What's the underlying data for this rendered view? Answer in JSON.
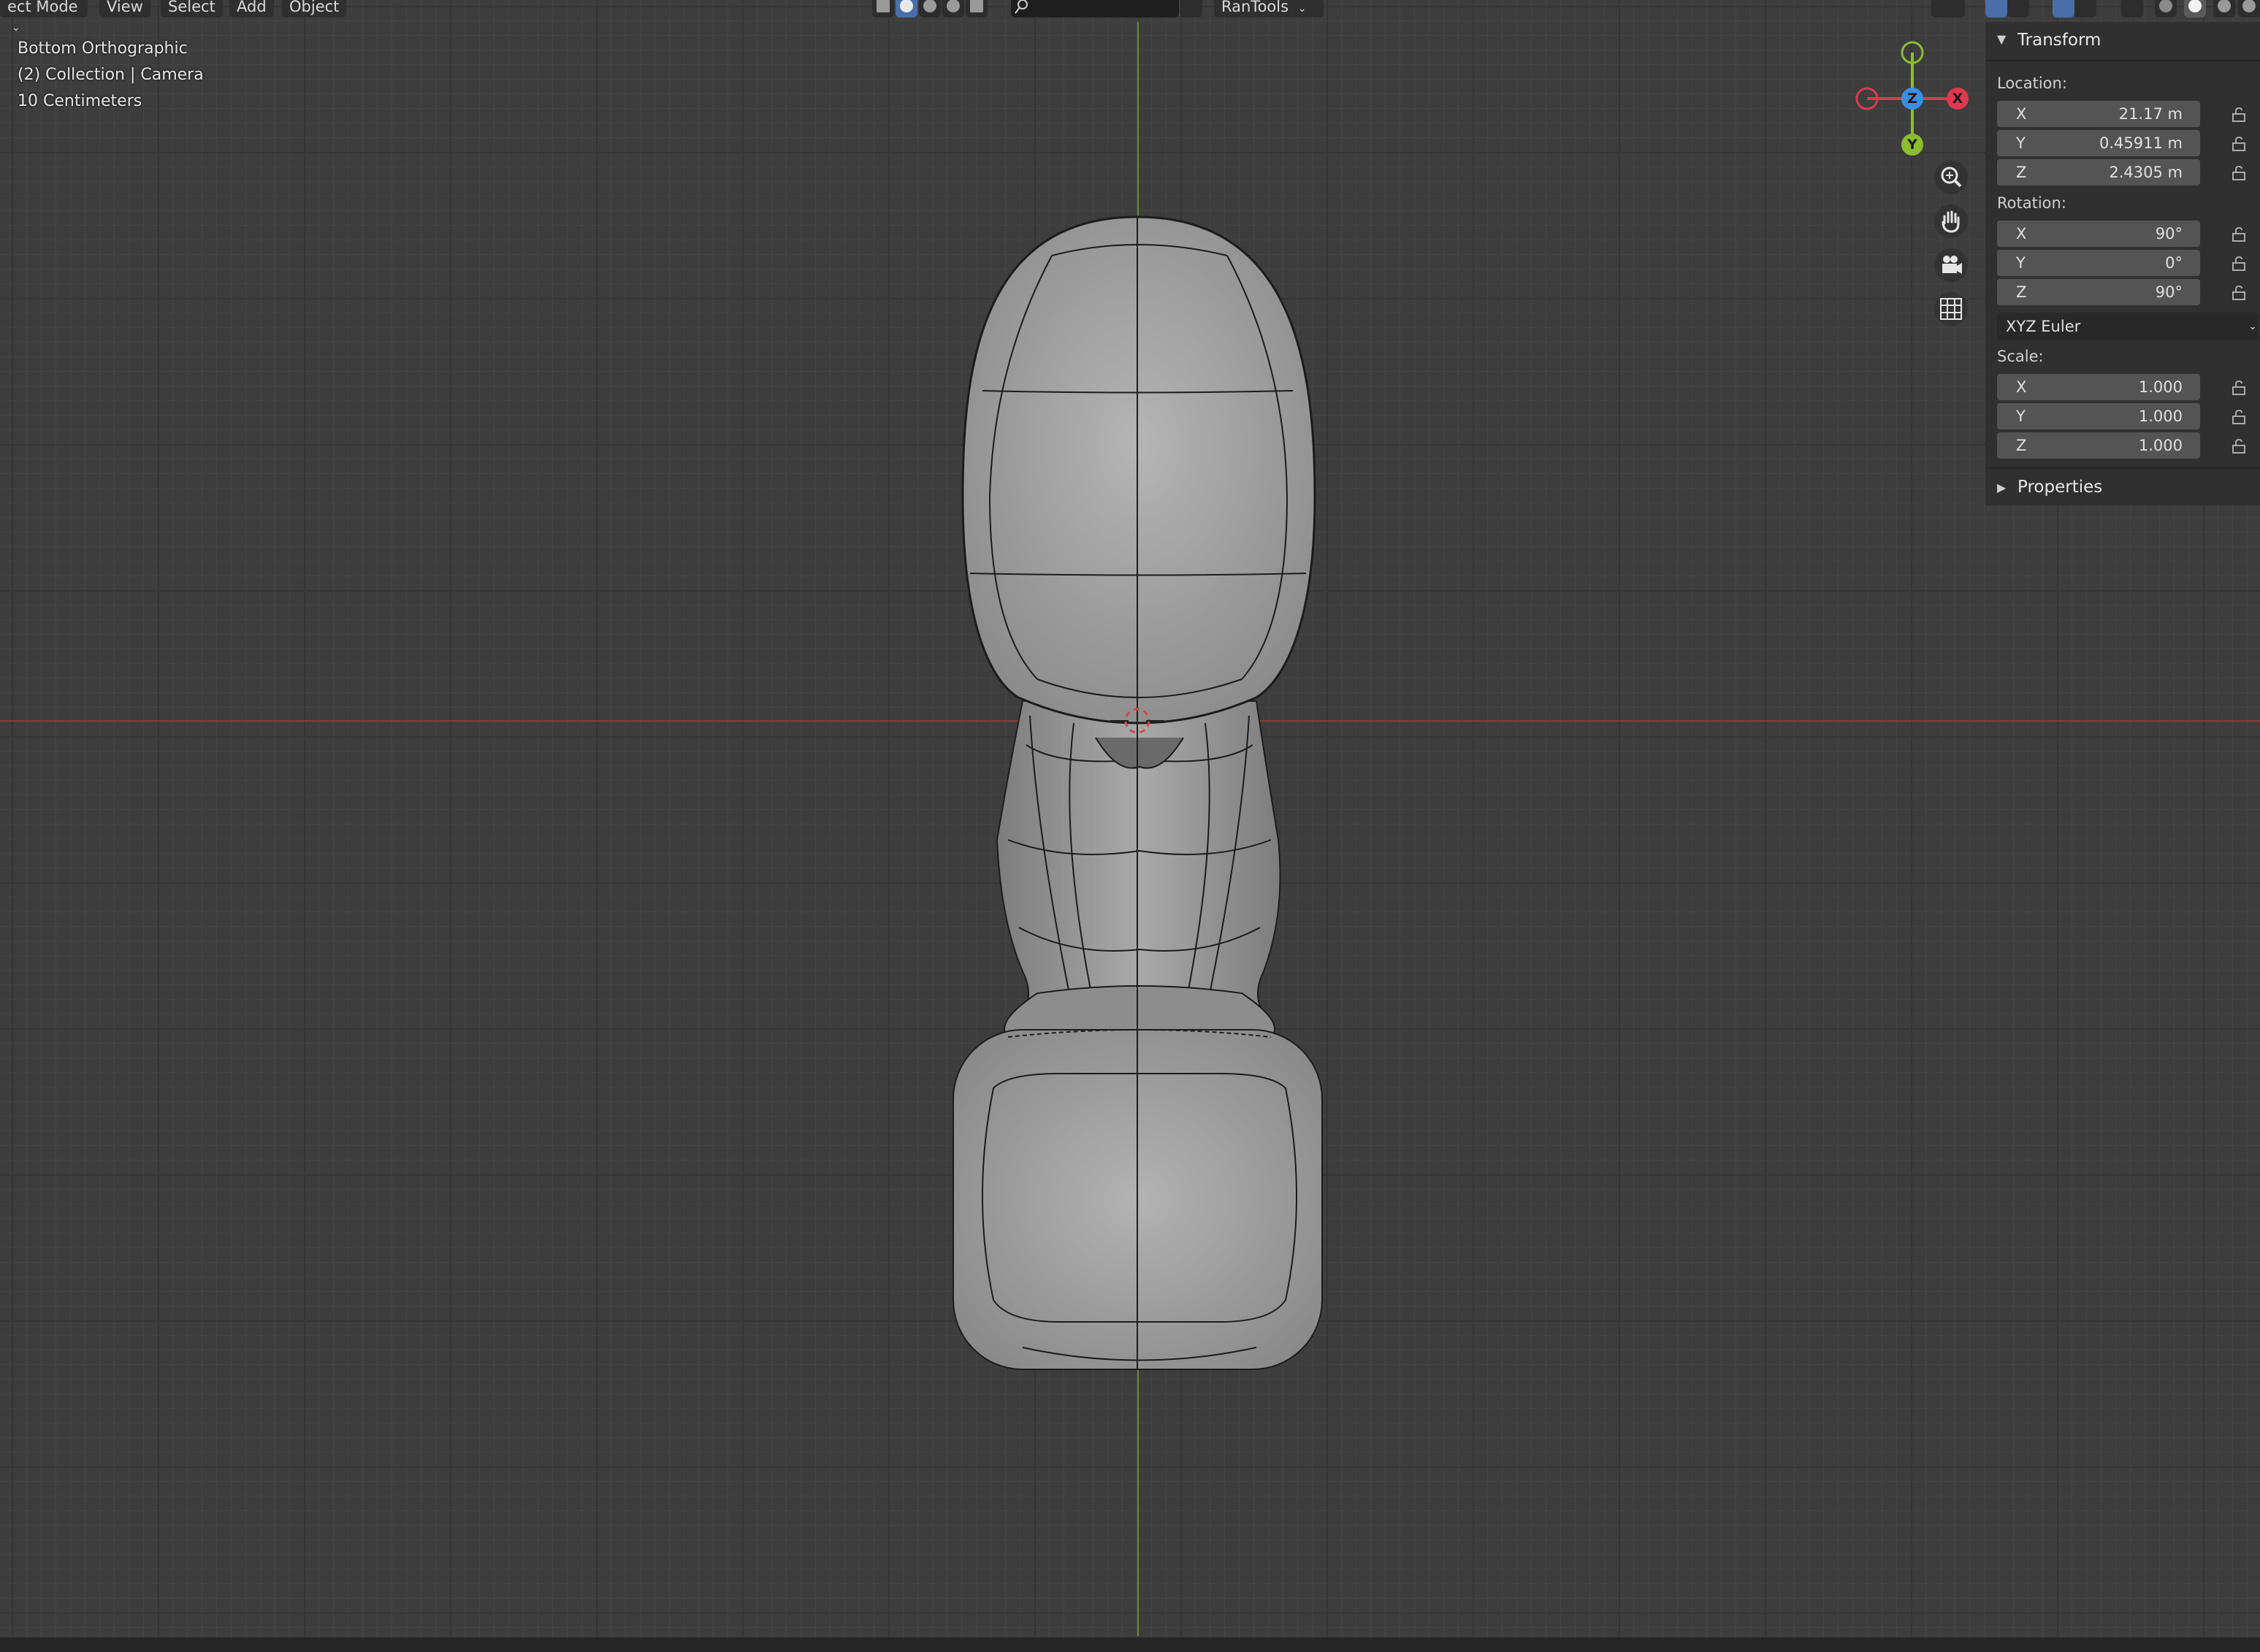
{
  "header": {
    "mode_label": "ect Mode",
    "menus": [
      "View",
      "Select",
      "Add",
      "Object"
    ],
    "addon_label": "RanTools"
  },
  "viewport_overlay": {
    "view_name": "Bottom Orthographic",
    "collection_info": "(2) Collection | Camera",
    "grid_scale": "10 Centimeters"
  },
  "gizmo": {
    "x_label": "X",
    "y_label": "Y",
    "z_label": "Z",
    "colors": {
      "x": "#e0384f",
      "y": "#8bbd2f",
      "z": "#3a8ee6"
    }
  },
  "nav_icons": [
    "zoom-icon",
    "hand-pan-icon",
    "camera-icon",
    "grid-icon"
  ],
  "npanel": {
    "transform_title": "Transform",
    "location_label": "Location:",
    "location": [
      {
        "axis": "X",
        "value": "21.17 m"
      },
      {
        "axis": "Y",
        "value": "0.45911 m"
      },
      {
        "axis": "Z",
        "value": "2.4305 m"
      }
    ],
    "rotation_label": "Rotation:",
    "rotation": [
      {
        "axis": "X",
        "value": "90°"
      },
      {
        "axis": "Y",
        "value": "0°"
      },
      {
        "axis": "Z",
        "value": "90°"
      }
    ],
    "rotation_mode": "XYZ Euler",
    "scale_label": "Scale:",
    "scale": [
      {
        "axis": "X",
        "value": "1.000"
      },
      {
        "axis": "Y",
        "value": "1.000"
      },
      {
        "axis": "Z",
        "value": "1.000"
      }
    ],
    "properties_title": "Properties"
  }
}
